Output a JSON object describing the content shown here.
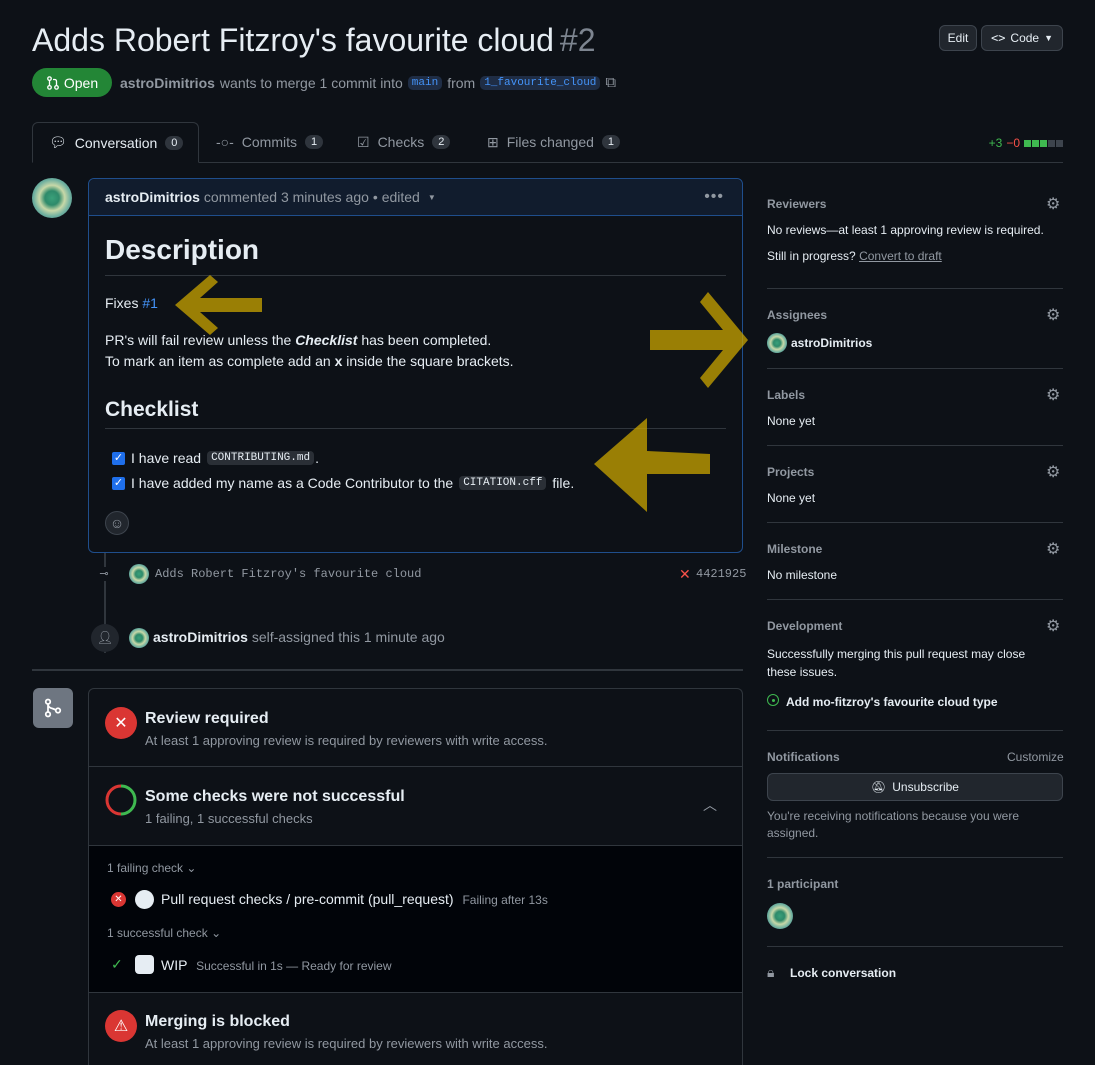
{
  "pr": {
    "title": "Adds Robert Fitzroy's favourite cloud",
    "number": "#2",
    "state": "Open",
    "author": "astroDimitrios",
    "merge_text": "wants to merge 1 commit into",
    "base": "main",
    "from": "from",
    "head": "1_favourite_cloud"
  },
  "header": {
    "edit": "Edit",
    "code": "Code"
  },
  "tabs": [
    {
      "label": "Conversation",
      "count": "0"
    },
    {
      "label": "Commits",
      "count": "1"
    },
    {
      "label": "Checks",
      "count": "2"
    },
    {
      "label": "Files changed",
      "count": "1"
    }
  ],
  "diffstat": {
    "add": "+3",
    "del": "−0"
  },
  "comment": {
    "author": "astroDimitrios",
    "action": "commented 3 minutes ago",
    "edited": "• edited",
    "h1": "Description",
    "fixes": "Fixes",
    "issue": "#1",
    "p1_a": "PR's will fail review unless the",
    "p1_b": "Checklist",
    "p1_c": "has been completed.",
    "p2_a": "To mark an item as complete add an",
    "p2_b": "x",
    "p2_c": "inside the square brackets.",
    "h2": "Checklist",
    "item1_a": "I have read",
    "item1_code": "CONTRIBUTING.md",
    "item1_b": ".",
    "item2_a": "I have added my name as a Code Contributor to the",
    "item2_code": "CITATION.cff",
    "item2_b": "file."
  },
  "commit": {
    "message": "Adds Robert Fitzroy's favourite cloud",
    "sha": "4421925"
  },
  "event": {
    "author": "astroDimitrios",
    "text": "self-assigned this 1 minute ago"
  },
  "merge": {
    "review_title": "Review required",
    "review_sub": "At least 1 approving review is required by reviewers with write access.",
    "checks_title": "Some checks were not successful",
    "checks_sub": "1 failing, 1 successful checks",
    "failing_label": "1 failing check",
    "failing_name": "Pull request checks / pre-commit (pull_request)",
    "failing_status": "Failing after 13s",
    "success_label": "1 successful check",
    "success_name": "WIP",
    "success_status": "Successful in 1s — Ready for review",
    "blocked_title": "Merging is blocked",
    "blocked_sub": "At least 1 approving review is required by reviewers with write access."
  },
  "sidebar": {
    "reviewers_title": "Reviewers",
    "reviewers_text": "No reviews—at least 1 approving review is required.",
    "draft_text": "Still in progress?",
    "draft_link": "Convert to draft",
    "assignees_title": "Assignees",
    "assignee": "astroDimitrios",
    "labels_title": "Labels",
    "labels_text": "None yet",
    "projects_title": "Projects",
    "projects_text": "None yet",
    "milestone_title": "Milestone",
    "milestone_text": "No milestone",
    "development_title": "Development",
    "development_text": "Successfully merging this pull request may close these issues.",
    "development_issue": "Add mo-fitzroy's favourite cloud type",
    "notifications_title": "Notifications",
    "customize": "Customize",
    "unsubscribe": "Unsubscribe",
    "notifications_text": "You're receiving notifications because you were assigned.",
    "participants_title": "1 participant",
    "lock": "Lock conversation"
  }
}
